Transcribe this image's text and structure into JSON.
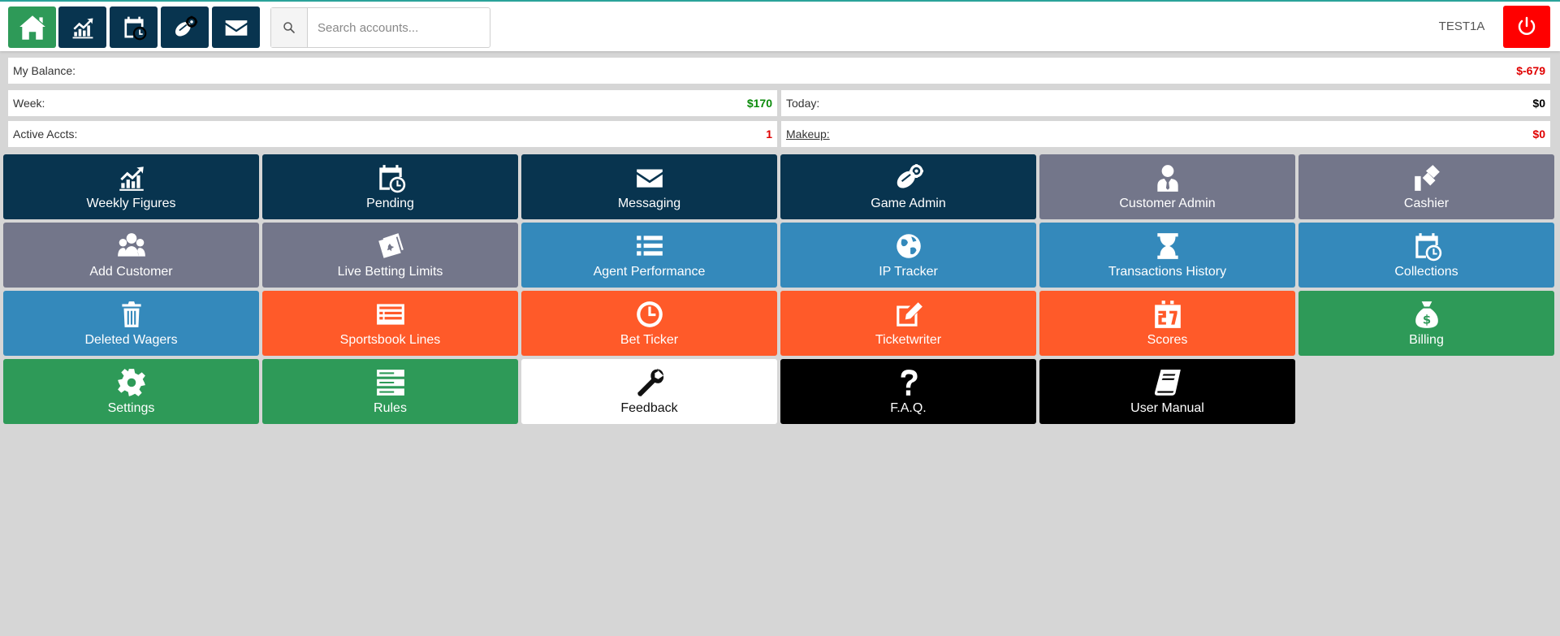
{
  "header": {
    "nav_buttons": [
      {
        "icon": "home-icon",
        "color": "#2e9a58"
      },
      {
        "icon": "chart-up-icon",
        "color": "#08344f"
      },
      {
        "icon": "calendar-clock-icon",
        "color": "#08344f"
      },
      {
        "icon": "football-gear-icon",
        "color": "#08344f"
      },
      {
        "icon": "envelope-icon",
        "color": "#08344f"
      }
    ],
    "search_placeholder": "Search accounts...",
    "search_value": "",
    "username": "TEST1A",
    "power_color": "#ff0000"
  },
  "stats": {
    "balance_label": "My Balance:",
    "balance_value": "$-679",
    "week_label": "Week:",
    "week_value": "$170",
    "today_label": "Today:",
    "today_value": "$0",
    "active_label": "Active Accts:",
    "active_value": "1",
    "makeup_label": "Makeup:",
    "makeup_value": "$0",
    "colors": {
      "negative": "#e00000",
      "positive": "#0a8a0a",
      "neutral": "#000000"
    }
  },
  "tiles": [
    {
      "label": "Weekly Figures",
      "icon": "chart-up-icon",
      "color": "navy"
    },
    {
      "label": "Pending",
      "icon": "calendar-clock-icon",
      "color": "navy"
    },
    {
      "label": "Messaging",
      "icon": "envelope-icon",
      "color": "navy"
    },
    {
      "label": "Game Admin",
      "icon": "football-gear-icon",
      "color": "navy"
    },
    {
      "label": "Customer Admin",
      "icon": "user-tie-icon",
      "color": "gray"
    },
    {
      "label": "Cashier",
      "icon": "hand-cash-icon",
      "color": "gray"
    },
    {
      "label": "Add Customer",
      "icon": "user-group-icon",
      "color": "gray"
    },
    {
      "label": "Live Betting Limits",
      "icon": "tickets-icon",
      "color": "gray"
    },
    {
      "label": "Agent Performance",
      "icon": "list-icon",
      "color": "blue"
    },
    {
      "label": "IP Tracker",
      "icon": "globe-icon",
      "color": "blue"
    },
    {
      "label": "Transactions History",
      "icon": "hourglass-icon",
      "color": "blue"
    },
    {
      "label": "Collections",
      "icon": "calendar-clock-icon",
      "color": "blue"
    },
    {
      "label": "Deleted Wagers",
      "icon": "trash-icon",
      "color": "blue"
    },
    {
      "label": "Sportsbook Lines",
      "icon": "newspaper-icon",
      "color": "orange"
    },
    {
      "label": "Bet Ticker",
      "icon": "clock-icon",
      "color": "orange"
    },
    {
      "label": "Ticketwriter",
      "icon": "pencil-square-icon",
      "color": "orange"
    },
    {
      "label": "Scores",
      "icon": "scoreboard-icon",
      "color": "orange"
    },
    {
      "label": "Billing",
      "icon": "money-bag-icon",
      "color": "green"
    },
    {
      "label": "Settings",
      "icon": "gear-icon",
      "color": "green"
    },
    {
      "label": "Rules",
      "icon": "server-icon",
      "color": "green"
    },
    {
      "label": "Feedback",
      "icon": "wrench-icon",
      "color": "white"
    },
    {
      "label": "F.A.Q.",
      "icon": "question-icon",
      "color": "black"
    },
    {
      "label": "User Manual",
      "icon": "book-icon",
      "color": "black"
    }
  ]
}
